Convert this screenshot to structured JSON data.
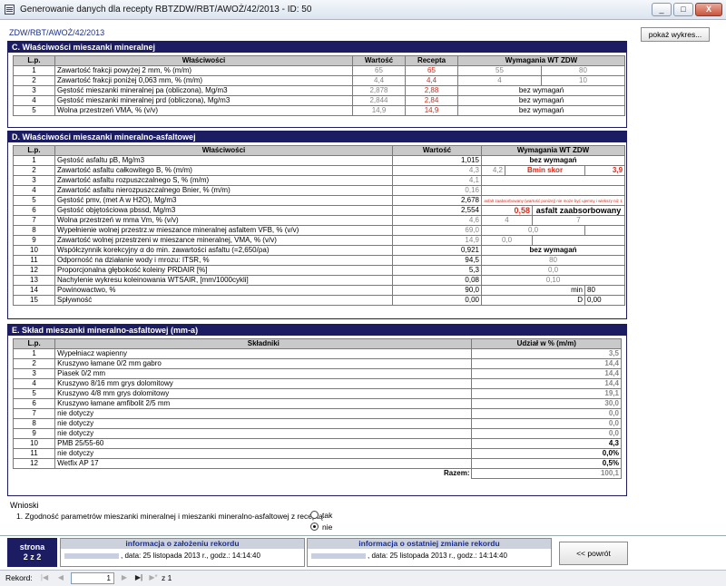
{
  "window": {
    "title": "Generowanie danych dla recepty RBTZDW/RBT/AWOŻ/42/2013 - ID: 50",
    "min": "_",
    "max": "□",
    "close": "X"
  },
  "subtitle": "ZDW/RBT/AWOŻ/42/2013",
  "show_button": "pokaż wykres...",
  "sectionC": {
    "title": "C. Właściwości mieszanki mineralnej",
    "headers": [
      "L.p.",
      "Właściwości",
      "Wartość",
      "Recepta",
      "Wymagania WT ZDW"
    ],
    "rows": [
      {
        "lp": "1",
        "name": "Zawartość frakcji powyżej 2 mm, % (m/m)",
        "val": "65",
        "rec": "65",
        "req1": "55",
        "req2": "80"
      },
      {
        "lp": "2",
        "name": "Zawartość frakcji poniżej 0,063 mm, % (m/m)",
        "val": "4,4",
        "rec": "4,4",
        "req1": "4",
        "req2": "10"
      },
      {
        "lp": "3",
        "name": "Gęstość mieszanki mineralnej pa (obliczona), Mg/m3",
        "val": "2,878",
        "rec": "2,88",
        "req": "bez wymagań"
      },
      {
        "lp": "4",
        "name": "Gęstość mieszanki mineralnej prd (obliczona), Mg/m3",
        "val": "2,844",
        "rec": "2,84",
        "req": "bez wymagań"
      },
      {
        "lp": "5",
        "name": "Wolna przestrzeń VMA, % (v/v)",
        "val": "14,9",
        "rec": "14,9",
        "req": "bez wymagań"
      }
    ]
  },
  "sectionD": {
    "title": "D. Właściwości mieszanki mineralno-asfaltowej",
    "headers": [
      "L.p.",
      "Właściwości",
      "Wartość",
      "Wymagania WT ZDW"
    ],
    "rows": [
      {
        "lp": "1",
        "name": "Gęstość asfaltu pB, Mg/m3",
        "val": "1,015",
        "req": "bez wymagań"
      },
      {
        "lp": "2",
        "name": "Zawartość asfaltu całkowitego B, % (m/m)",
        "val": "4,3",
        "a": "4,2",
        "b": "Bmin skor",
        "c": "3,9"
      },
      {
        "lp": "3",
        "name": "Zawartość asfaltu rozpuszczalnego S, % (m/m)",
        "val": "4,1"
      },
      {
        "lp": "4",
        "name": "Zawartość asfaltu nierozpuszczalnego Bnier, % (m/m)",
        "val": "0,16"
      },
      {
        "lp": "5",
        "name": "Gęstość pmv, (met A w H2O), Mg/m3",
        "val": "2,678",
        "note": "asfalt zaabsorbowany (wartość poniżej) nie może być ujemny i wiekszy niż 1"
      },
      {
        "lp": "6",
        "name": "Gęstość objętościowa pbssd, Mg/m3",
        "val": "2,554",
        "a": "0,58",
        "b": "asfalt zaabsorbowany"
      },
      {
        "lp": "7",
        "name": "Wolna przestrzeń w mma Vm, % (v/v)",
        "val": "4,6",
        "a": "4",
        "c": "7"
      },
      {
        "lp": "8",
        "name": "Wypełnienie wolnej  przestrz.w mieszance mineralnej asfaltem VFB, % (v/v)",
        "val": "69,0",
        "a": "0,0"
      },
      {
        "lp": "9",
        "name": "Zawartość wolnej przestrzeni w mieszance mineralnej, VMA, % (v/v)",
        "val": "14,9",
        "a": "0,0"
      },
      {
        "lp": "10",
        "name": "Współczynnik korekcyjny α do min. zawartości asfaltu (=2,650/ρa)",
        "val": "0,921",
        "req": "bez wymagań"
      },
      {
        "lp": "11",
        "name": "Odporność na działanie wody i mrozu:  ITSR, %",
        "val": "94,5",
        "a": "80"
      },
      {
        "lp": "12",
        "name": "Proporcjonalna głębokość koleiny PRDAIR [%]",
        "val": "5,3",
        "a": "0,0"
      },
      {
        "lp": "13",
        "name": "Nachylenie wykresu koleinowania WTSAIR, [mm/1000cykli]",
        "val": "0,08",
        "a": "0,10"
      },
      {
        "lp": "14",
        "name": "Powinowactwo, %",
        "val": "90,0",
        "a": "min",
        "b": "80"
      },
      {
        "lp": "15",
        "name": "Spływność",
        "val": "0,00",
        "a": "D",
        "b": "0,00"
      }
    ]
  },
  "sectionE": {
    "title": "E. Skład mieszanki mineralno-asfaltowej (mm-a)",
    "headers": [
      "L.p.",
      "Składniki",
      "Udział w % (m/m)"
    ],
    "rows": [
      {
        "lp": "1",
        "name": "Wypełniacz wapienny",
        "val": "3,5"
      },
      {
        "lp": "2",
        "name": "Kruszywo łamane 0/2 mm gabro",
        "val": "14,4"
      },
      {
        "lp": "3",
        "name": "Piasek 0/2 mm",
        "val": "14,4"
      },
      {
        "lp": "4",
        "name": "Kruszywo 8/16 mm grys dolomitowy",
        "val": "14,4"
      },
      {
        "lp": "5",
        "name": "Kruszywo 4/8 mm grys dolomitowy",
        "val": "19,1"
      },
      {
        "lp": "6",
        "name": "Kruszywo łamane amfibolit 2/5 mm",
        "val": "30,0"
      },
      {
        "lp": "7",
        "name": "nie dotyczy",
        "val": "0,0"
      },
      {
        "lp": "8",
        "name": "nie dotyczy",
        "val": "0,0"
      },
      {
        "lp": "9",
        "name": "nie dotyczy",
        "val": "0,0"
      },
      {
        "lp": "10",
        "name": "PMB 25/55-60",
        "val": "4,3"
      },
      {
        "lp": "11",
        "name": "nie dotyczy",
        "val": "0,0%"
      },
      {
        "lp": "12",
        "name": "Wetfix AP 17",
        "val": "0,5%"
      }
    ],
    "total_label": "Razem:",
    "total": "100,1"
  },
  "conclusions": {
    "title": "Wnioski",
    "item": "1. Zgodność parametrów mieszanki mineralnej i mieszanki mineralno-asfaltowej z receptą",
    "opt_yes": "tak",
    "opt_no": "nie",
    "selected": "nie"
  },
  "footer": {
    "page_label": "strona",
    "page_value": "2 z 2",
    "created_title": "informacja o założeniu rekordu",
    "created_text": ", data: 25 listopada 2013 r., godz.: 14:14:40",
    "modified_title": "informacja o ostatniej zmianie rekordu",
    "modified_text": ", data: 25 listopada 2013 r., godz.: 14:14:40",
    "back_button": "<< powrót"
  },
  "nav": {
    "label": "Rekord:",
    "first": "|◀",
    "prev": "◀",
    "current": "1",
    "next": "▶",
    "last": "▶|",
    "new": "▶*",
    "of": "z  1"
  }
}
